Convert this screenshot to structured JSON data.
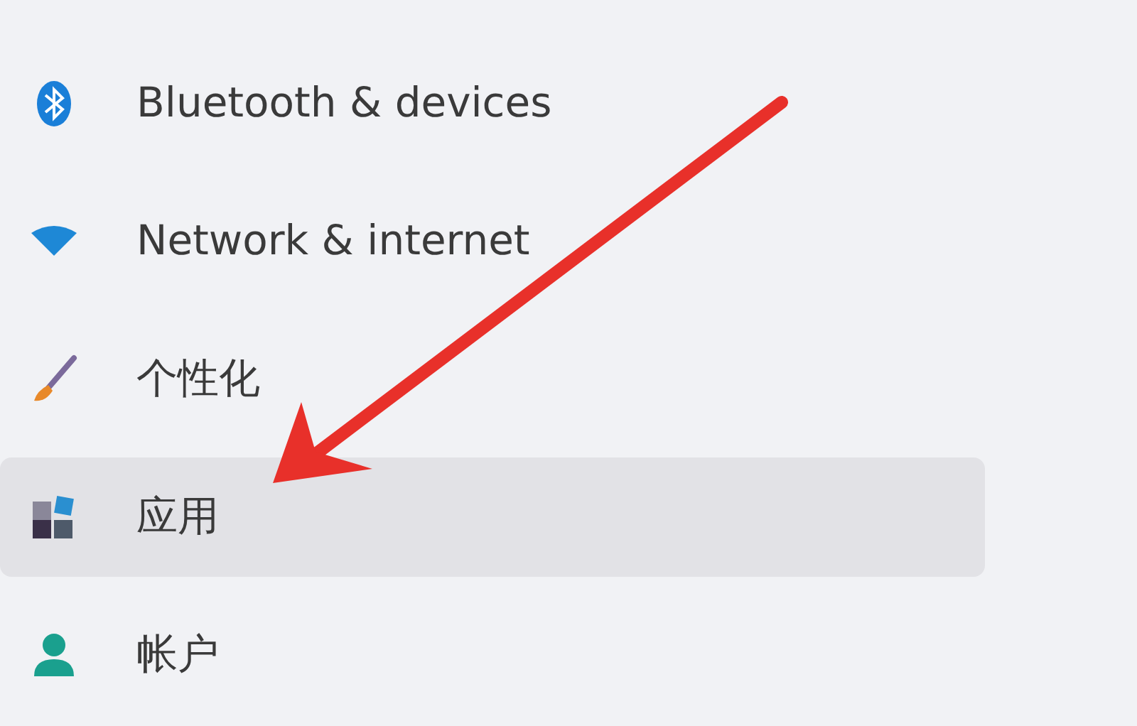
{
  "sidebar": {
    "items": [
      {
        "label": "Bluetooth & devices",
        "selected": false
      },
      {
        "label": "Network & internet",
        "selected": false
      },
      {
        "label": "个性化",
        "selected": false
      },
      {
        "label": "应用",
        "selected": true
      },
      {
        "label": "帐户",
        "selected": false
      }
    ]
  }
}
